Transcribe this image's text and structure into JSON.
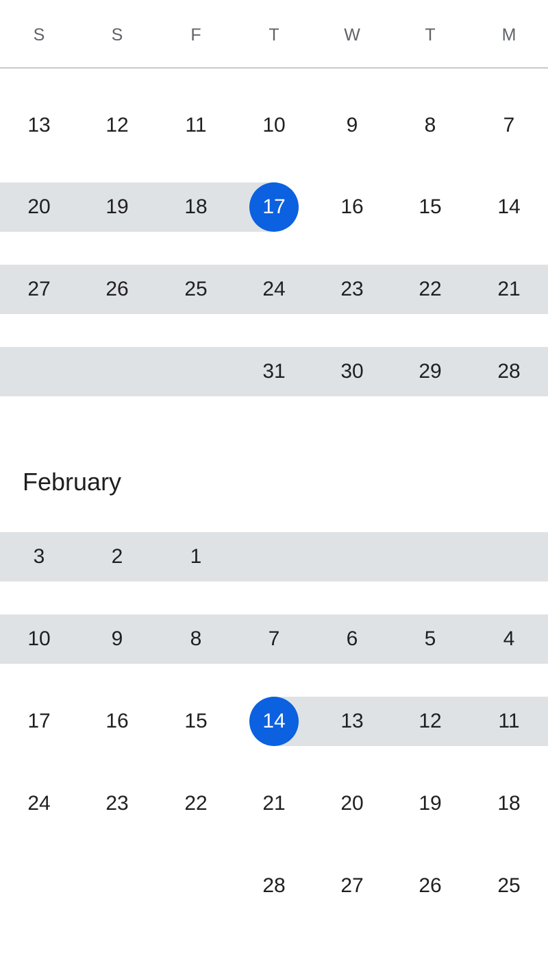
{
  "weekdays": [
    "S",
    "S",
    "F",
    "T",
    "W",
    "T",
    "M"
  ],
  "selection_color": "#0b61e0",
  "range_color": "#dfe2e5",
  "months": [
    {
      "title": "",
      "weeks": [
        [
          "13",
          "12",
          "11",
          "10",
          "9",
          "8",
          "7"
        ],
        [
          "20",
          "19",
          "18",
          "17",
          "16",
          "15",
          "14"
        ],
        [
          "27",
          "26",
          "25",
          "24",
          "23",
          "22",
          "21"
        ],
        [
          "",
          "",
          "",
          "31",
          "30",
          "29",
          "28"
        ]
      ],
      "range_start": "17"
    },
    {
      "title": "February",
      "weeks": [
        [
          "3",
          "2",
          "1",
          "",
          "",
          "",
          ""
        ],
        [
          "10",
          "9",
          "8",
          "7",
          "6",
          "5",
          "4"
        ],
        [
          "17",
          "16",
          "15",
          "14",
          "13",
          "12",
          "11"
        ],
        [
          "24",
          "23",
          "22",
          "21",
          "20",
          "19",
          "18"
        ],
        [
          "",
          "",
          "",
          "28",
          "27",
          "26",
          "25"
        ]
      ],
      "range_end": "14"
    }
  ]
}
